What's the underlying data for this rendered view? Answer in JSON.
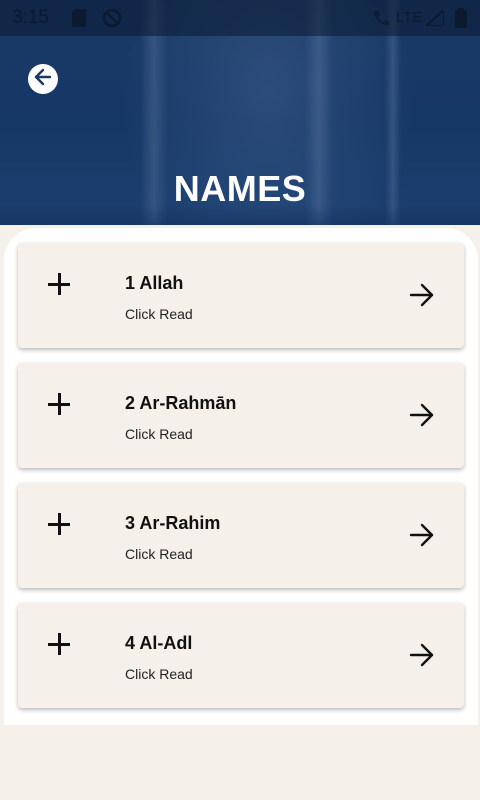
{
  "status_bar": {
    "time": "3:15",
    "network": "LTE"
  },
  "header": {
    "back_icon": "arrow-left-circle-icon",
    "title": "NAMES"
  },
  "names": [
    {
      "title": "1 Allah",
      "subtitle": "Click Read"
    },
    {
      "title": "2 Ar-Rahmān",
      "subtitle": "Click Read"
    },
    {
      "title": "3 Ar-Rahim",
      "subtitle": "Click Read"
    },
    {
      "title": "4 Al-Adl",
      "subtitle": "Click Read"
    }
  ],
  "colors": {
    "header_bg": "#163866",
    "card_bg": "#f6f0ea",
    "panel_bg": "#ffffff"
  }
}
